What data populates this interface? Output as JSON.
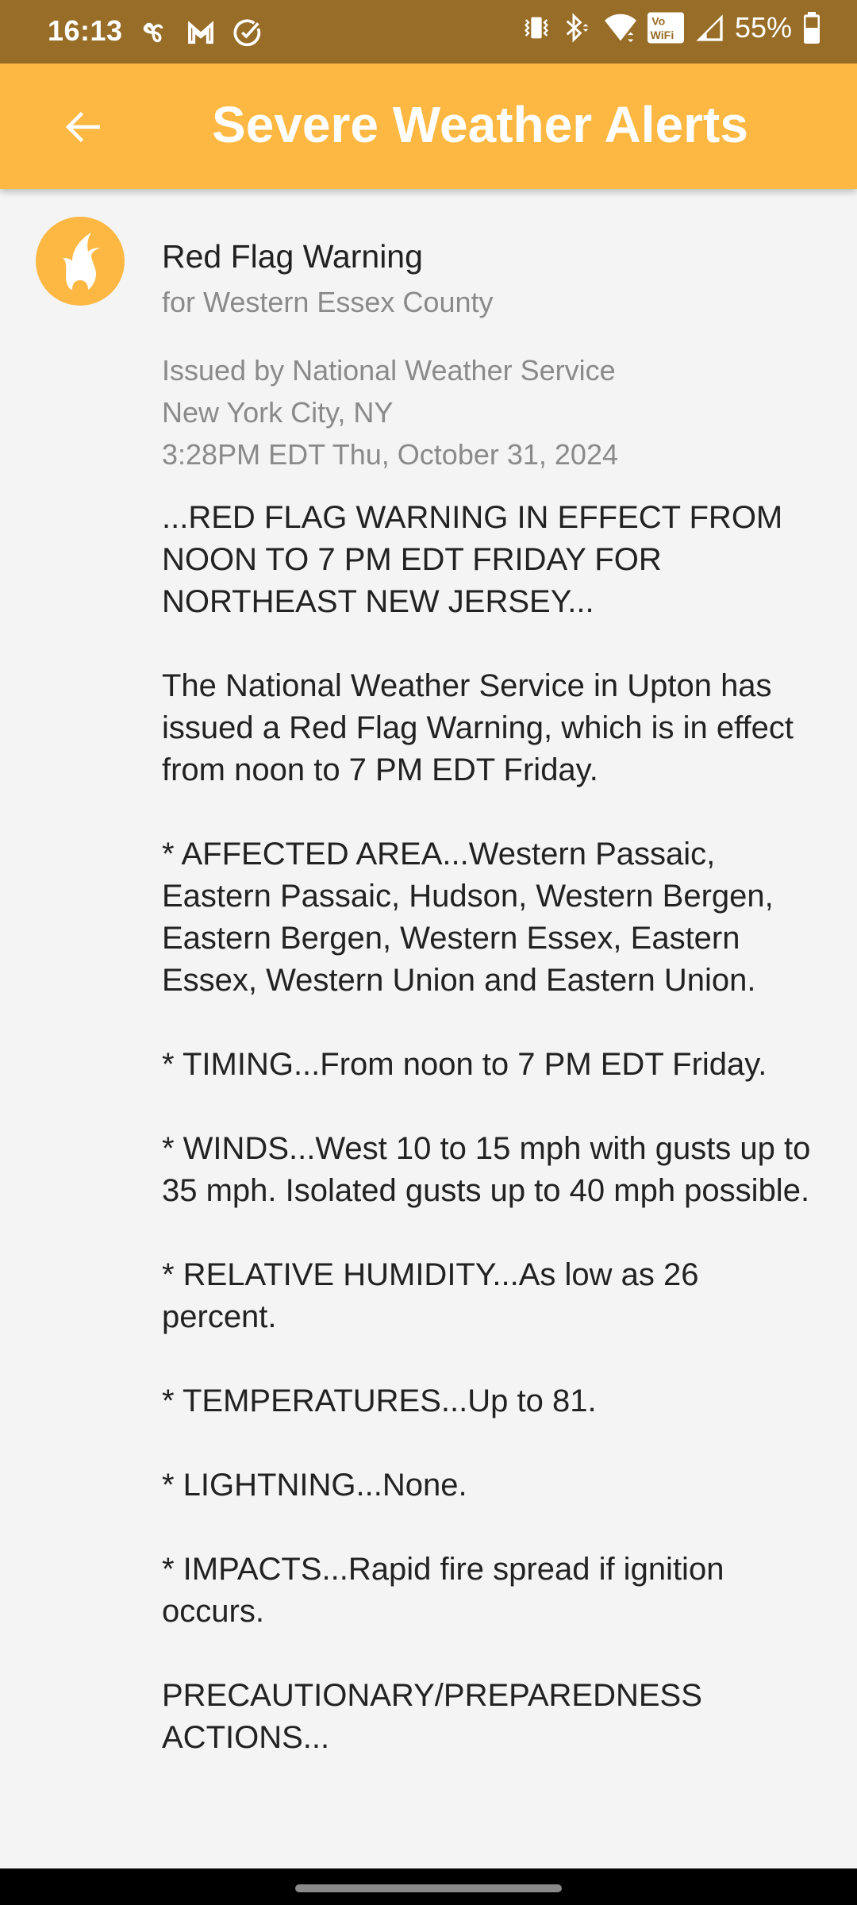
{
  "status_bar": {
    "time": "16:13",
    "left_icons": [
      "pinwheel-icon",
      "gmail-icon",
      "check-circle-icon"
    ],
    "right_icons": [
      "vibrate-icon",
      "bluetooth-icon",
      "wifi-icon",
      "vowifi-icon",
      "cell-signal-icon",
      "battery-icon"
    ],
    "battery_percent": "55%"
  },
  "app_bar": {
    "back_icon": "arrow-back-icon",
    "title": "Severe Weather Alerts"
  },
  "colors": {
    "status_bar": "#976d27",
    "accent": "#fcb843",
    "background": "#f4f4f4"
  },
  "alert": {
    "icon": "flame-icon",
    "title": "Red Flag Warning",
    "subtitle": "for Western Essex County",
    "issued_lines": [
      "Issued by National Weather Service",
      "New York City, NY",
      "3:28PM EDT Thu, October 31, 2024"
    ],
    "body_paragraphs": [
      "...RED FLAG WARNING IN EFFECT FROM NOON TO 7 PM EDT FRIDAY FOR NORTHEAST NEW JERSEY...",
      "The National Weather Service in Upton has issued a Red Flag Warning, which is in effect from noon to 7 PM EDT Friday.",
      "* AFFECTED AREA...Western Passaic, Eastern Passaic, Hudson, Western Bergen, Eastern Bergen, Western Essex, Eastern Essex, Western Union and Eastern Union.",
      "* TIMING...From noon to 7 PM EDT Friday.",
      "* WINDS...West 10 to 15 mph with gusts up to 35 mph. Isolated gusts up to 40 mph possible.",
      "* RELATIVE HUMIDITY...As low as 26 percent.",
      "* TEMPERATURES...Up to 81.",
      "* LIGHTNING...None.",
      "* IMPACTS...Rapid fire spread if ignition occurs.",
      "PRECAUTIONARY/PREPAREDNESS ACTIONS..."
    ]
  }
}
